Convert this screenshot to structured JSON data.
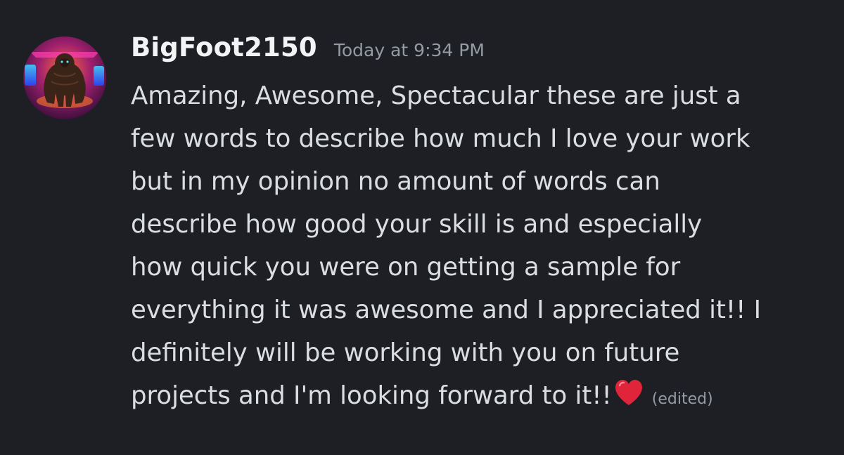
{
  "message": {
    "username": "BigFoot2150",
    "timestamp": "Today at 9:34 PM",
    "lines": [
      "Amazing, Awesome, Spectacular these are just a",
      "few words to describe how much I love your work",
      "but in my opinion no amount of words can",
      "describe how good your skill is and especially",
      "how quick you were on getting a sample for",
      "everything it was awesome and I appreciated it!! I",
      "definitely will be working with you on future",
      "projects and I'm looking forward to it!!"
    ],
    "emoji": "heart-emoji",
    "edited_label": "(edited)",
    "avatar_icon": "bigfoot-avatar-icon"
  },
  "colors": {
    "background": "#1e1f24",
    "username": "#f2f3f5",
    "timestamp": "#949ba4",
    "text": "#dbdee1",
    "heart": "#e0243a"
  }
}
